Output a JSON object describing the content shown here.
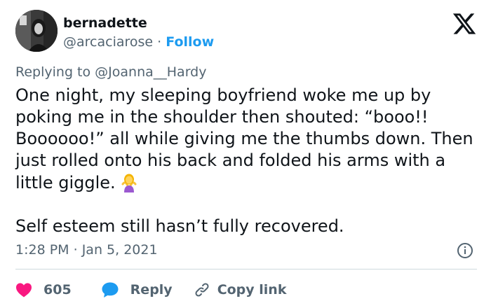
{
  "tweet": {
    "author_name": "bernadette",
    "author_handle": "@arcaciarose",
    "separator": "·",
    "follow_label": "Follow",
    "replying_prefix": "Replying to",
    "replying_to": "@Joanna__Hardy",
    "body_paragraph_1": "One night, my sleeping boyfriend woke me up by poking me in the shoulder then shouted: “booo!! Boooooo!” all while giving me the thumbs down. Then just rolled onto his back and folded his arms with a little giggle.",
    "body_paragraph_2": "Self esteem still hasn’t fully recovered.",
    "time": "1:28 PM",
    "date_separator": "·",
    "date": "Jan 5, 2021",
    "like_count": "605",
    "reply_label": "Reply",
    "copy_link_label": "Copy link"
  },
  "icons": {
    "logo": "x-logo-icon",
    "info": "info-icon",
    "like": "heart-icon",
    "reply": "speech-bubble-icon",
    "copy": "link-icon",
    "emoji": "person-shrugging-emoji"
  },
  "colors": {
    "text": "#0f1419",
    "secondary": "#536471",
    "accent": "#1d9bf0",
    "like": "#f91880",
    "divider": "#cfd9de"
  }
}
